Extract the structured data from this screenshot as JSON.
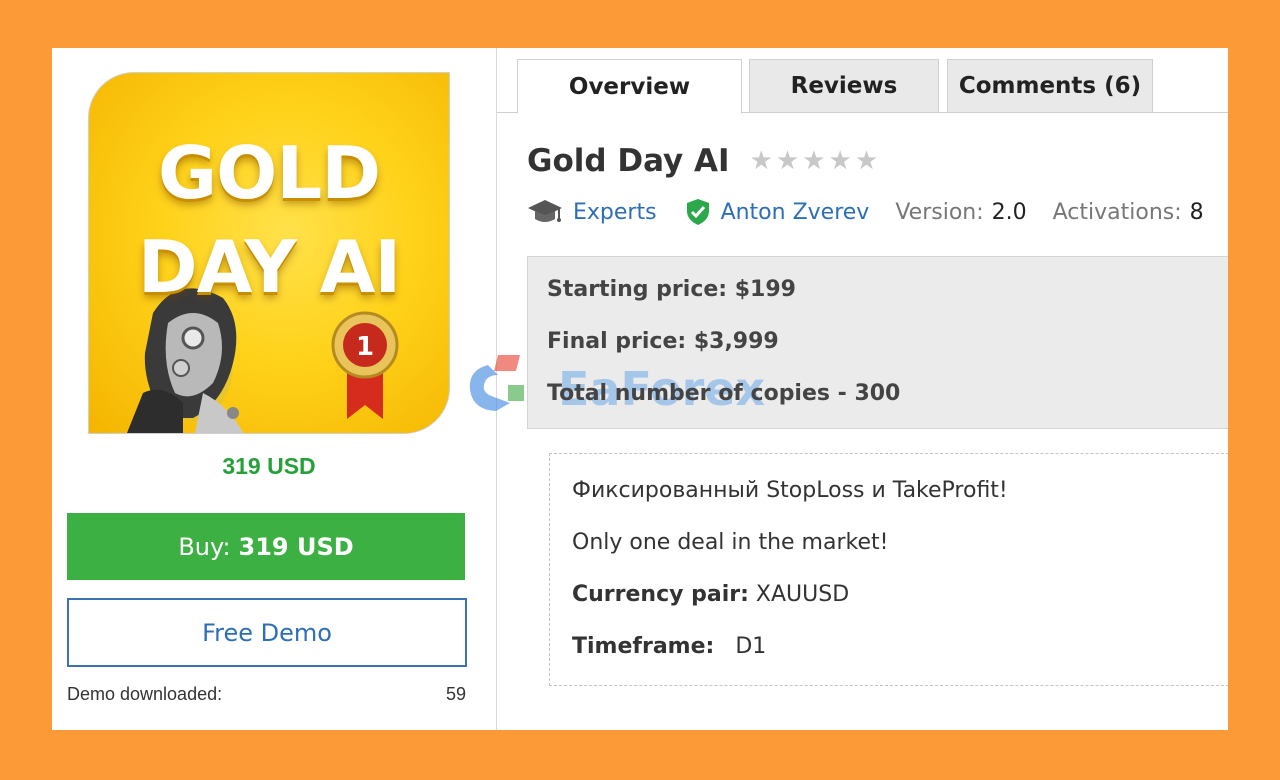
{
  "product": {
    "image_line1": "GOLD",
    "image_line2": "DAY AI",
    "medal_number": "1",
    "price_text": "319 USD",
    "buy_prefix": "Buy:",
    "buy_amount": "319 USD",
    "free_demo_label": "Free Demo",
    "demo_downloaded_label": "Demo downloaded:",
    "demo_downloaded_count": "59"
  },
  "tabs": [
    {
      "label": "Overview",
      "active": true
    },
    {
      "label": "Reviews",
      "active": false
    },
    {
      "label": "Comments (6)",
      "active": false
    }
  ],
  "header": {
    "title": "Gold Day AI",
    "rating": 0,
    "max_rating": 5,
    "category": "Experts",
    "author": "Anton Zverev",
    "version_label": "Version:",
    "version_value": "2.0",
    "activations_label": "Activations:",
    "activations_value": "8"
  },
  "pricing": {
    "starting_price": "Starting price: $199",
    "final_price": "Final price: $3,999",
    "total_copies": "Total number of copies - 300"
  },
  "watermark": {
    "text": "EaForex"
  },
  "description": {
    "line1": "Фиксированный StopLoss и TakeProfit!",
    "line2": "Only one deal in the market!",
    "pair_label": "Currency pair:",
    "pair_value": "XAUUSD",
    "timeframe_label": "Timeframe:",
    "timeframe_value": "D1"
  },
  "colors": {
    "background": "#fd9a38",
    "buy_green": "#3cb042",
    "price_green": "#26a13a",
    "link_blue": "#2d6fb7",
    "verified_green": "#2aa84a"
  }
}
